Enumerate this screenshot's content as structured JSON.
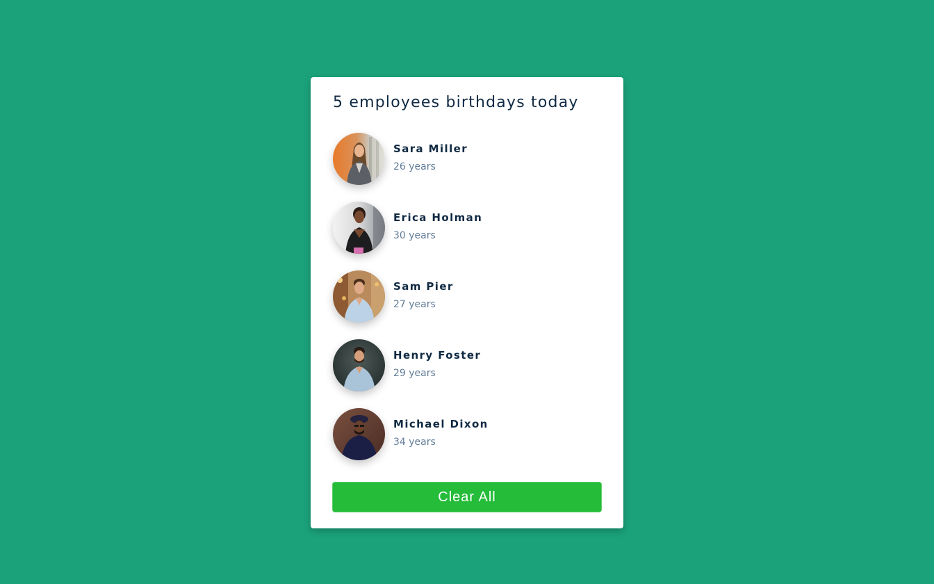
{
  "card": {
    "title": "5 employees birthdays today"
  },
  "people": [
    {
      "name": "Sara Miller",
      "age": "26 years",
      "avatar": "avatar-woman-orange-background"
    },
    {
      "name": "Erica Holman",
      "age": "30 years",
      "avatar": "avatar-woman-dark-top"
    },
    {
      "name": "Sam Pier",
      "age": "27 years",
      "avatar": "avatar-man-light-shirt"
    },
    {
      "name": "Henry Foster",
      "age": "29 years",
      "avatar": "avatar-man-grey-background"
    },
    {
      "name": "Michael Dixon",
      "age": "34 years",
      "avatar": "avatar-man-beret"
    }
  ],
  "actions": {
    "clear_label": "Clear All"
  },
  "colors": {
    "background": "#1ba27a",
    "card": "#ffffff",
    "primary_text": "#102a43",
    "secondary_text": "#627d98",
    "button": "#24bc39"
  }
}
